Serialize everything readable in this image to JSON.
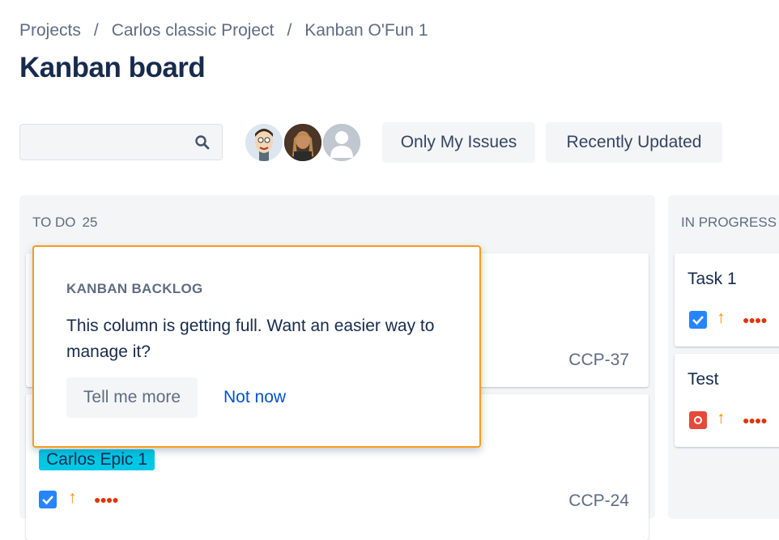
{
  "breadcrumb": {
    "items": [
      "Projects",
      "Carlos classic Project",
      "Kanban O'Fun 1"
    ],
    "separator": "/"
  },
  "page_title": "Kanban board",
  "search": {
    "placeholder": "",
    "value": ""
  },
  "filters": {
    "only_my_issues": "Only My Issues",
    "recently_updated": "Recently Updated"
  },
  "columns": {
    "todo": {
      "name": "TO DO",
      "count": "25"
    },
    "in_progress": {
      "name": "IN PROGRESS"
    }
  },
  "cards": {
    "todo_1": {
      "key": "CCP-37"
    },
    "todo_2": {
      "epic": "Carlos Epic 1",
      "key": "CCP-24",
      "type_icon": "task-checkbox-icon",
      "priority_icon": "arrow-up-icon"
    },
    "progress_1": {
      "title": "Task 1",
      "type_icon": "task-checkbox-icon",
      "priority_icon": "arrow-up-icon"
    },
    "progress_2": {
      "title": "Test",
      "type_icon": "bug-icon",
      "priority_icon": "arrow-up-icon"
    }
  },
  "popup": {
    "title": "KANBAN BACKLOG",
    "body": "This column is getting full. Want an easier way to manage it?",
    "primary": "Tell me more",
    "secondary": "Not now"
  },
  "colors": {
    "accent": "#0052cc",
    "popup_border": "#ff991f",
    "epic": "#00c7e6",
    "priority": "#ff8b00",
    "bug": "#e5493a",
    "task": "#2684ff"
  }
}
